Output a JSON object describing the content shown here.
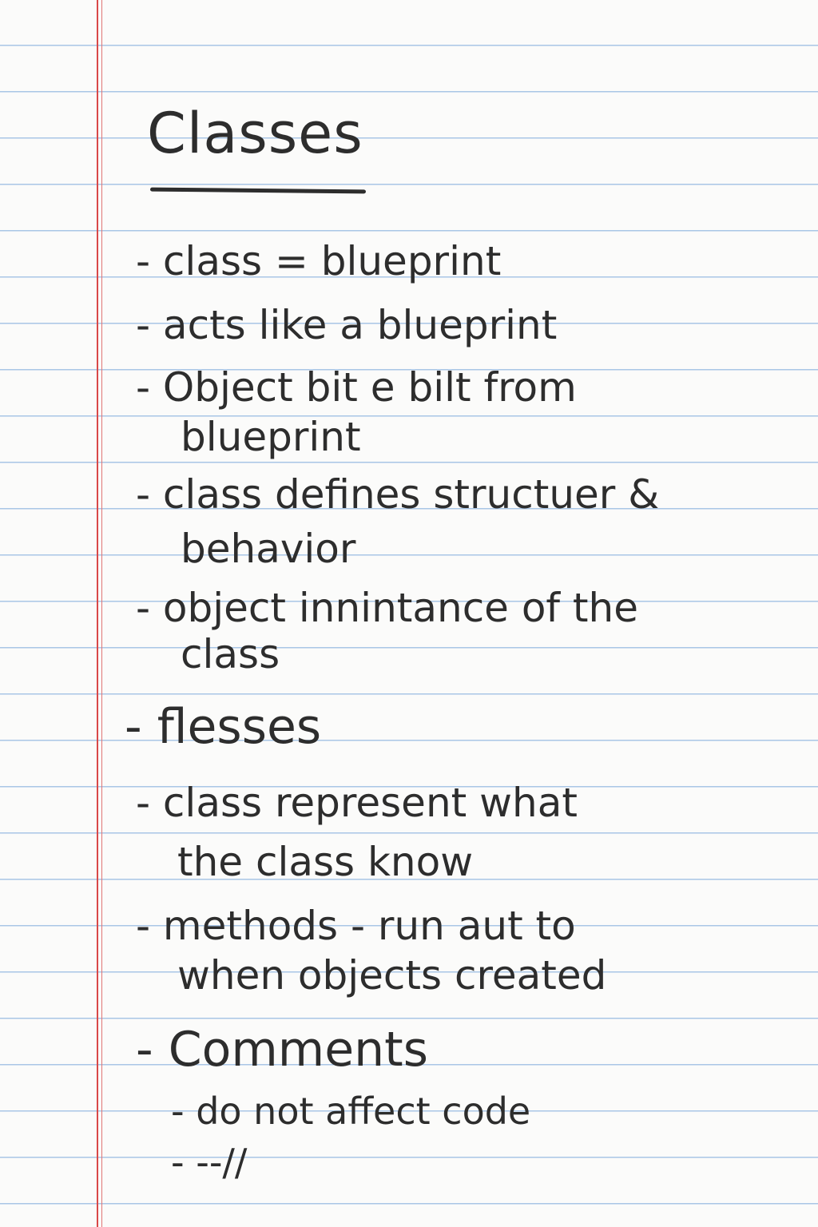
{
  "title": "Classes",
  "lines": [
    {
      "text": "- class = blueprint"
    },
    {
      "text": "- acts like a blueprint"
    },
    {
      "text": "- Object bit e bilt from"
    },
    {
      "text": "blueprint"
    },
    {
      "text": "- class defines structuer &"
    },
    {
      "text": "behavior"
    },
    {
      "text": "- object innintance of the"
    },
    {
      "text": "class"
    },
    {
      "text": "- flesses"
    },
    {
      "text": "- class represent what"
    },
    {
      "text": "the class know"
    },
    {
      "text": "- methods - run aut to"
    },
    {
      "text": "when objects created"
    },
    {
      "text": "- Comments"
    },
    {
      "text": "- do not affect code"
    },
    {
      "text": "- --//"
    }
  ]
}
